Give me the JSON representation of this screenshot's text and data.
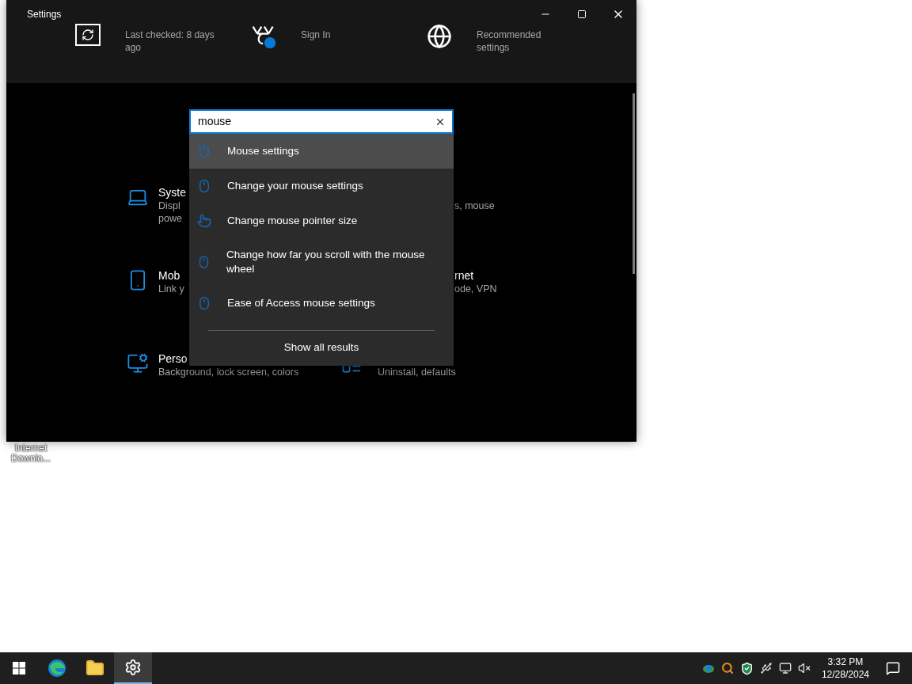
{
  "window": {
    "title": "Settings"
  },
  "header_items": [
    {
      "kind": "sync",
      "subtitle": "Last checked: 8 days ago"
    },
    {
      "kind": "rewards",
      "subtitle": "Sign In"
    },
    {
      "kind": "globe",
      "subtitle": "Recommended settings"
    }
  ],
  "search": {
    "value": "mouse"
  },
  "results": [
    {
      "kind": "mouse",
      "label": "Mouse settings",
      "selected": true
    },
    {
      "kind": "mouse",
      "label": "Change your mouse settings",
      "selected": false
    },
    {
      "kind": "pointer",
      "label": "Change mouse pointer size",
      "selected": false
    },
    {
      "kind": "mouse",
      "label": "Change how far you scroll with the mouse wheel",
      "selected": false
    },
    {
      "kind": "mouse",
      "label": "Ease of Access mouse settings",
      "selected": false
    }
  ],
  "show_all": "Show all results",
  "tile_rows": [
    {
      "left": {
        "kind": "laptop",
        "title": "Syste",
        "description_lines": [
          "Displ",
          "powe"
        ]
      },
      "right": {
        "description_lines": [
          "s, mouse"
        ]
      }
    },
    {
      "left": {
        "kind": "phone",
        "title": "Mob",
        "description_lines": [
          "Link y"
        ]
      },
      "right": {
        "title": "rnet",
        "description_lines": [
          "ode, VPN"
        ]
      }
    },
    {
      "left": {
        "kind": "personalize",
        "title": "Perso",
        "description_lines": [
          "Background, lock screen, colors"
        ]
      },
      "right": {
        "kind": "apps",
        "description_lines": [
          "Uninstall, defaults"
        ]
      }
    }
  ],
  "desktop_icon": {
    "label_lines": [
      "Internet",
      "Downlo..."
    ]
  },
  "taskbar": {
    "apps": [
      {
        "kind": "edge",
        "selected": false
      },
      {
        "kind": "folder",
        "selected": false
      },
      {
        "kind": "settings",
        "selected": true
      }
    ],
    "time": "3:32 PM",
    "date": "12/28/2024"
  }
}
